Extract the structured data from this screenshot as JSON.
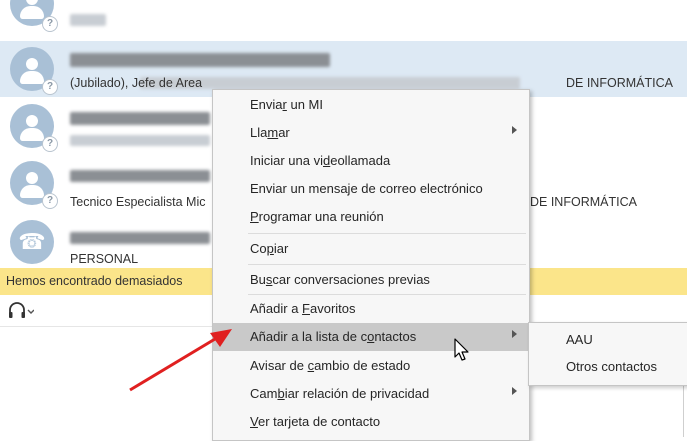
{
  "contacts": [
    {
      "line2": ""
    },
    {
      "line2_prefix": "(Jubilado), Jefe de Area",
      "line2_suffix": "DE INFORMÁTICA"
    },
    {
      "line2": ""
    },
    {
      "line2_prefix": "Tecnico Especialista Mic",
      "line2_suffix": "DE INFORMÁTICA"
    },
    {
      "line2": "PERSONAL"
    }
  ],
  "banner_text": "Hemos encontrado demasiados",
  "toolbar_icon": "headset-icon",
  "context_menu": {
    "items": [
      {
        "pre": "Envia",
        "u": "r",
        "post": " un MI"
      },
      {
        "pre": "Lla",
        "u": "m",
        "post": "ar"
      },
      {
        "pre": "Iniciar una vi",
        "u": "d",
        "post": "eollamada"
      },
      {
        "pre": "Enviar un mensaje de correo electrónico",
        "u": "",
        "post": ""
      },
      {
        "pre": "",
        "u": "P",
        "post": "rogramar una reunión"
      },
      {
        "pre": "Co",
        "u": "p",
        "post": "iar"
      },
      {
        "pre": "Bu",
        "u": "s",
        "post": "car conversaciones previas"
      },
      {
        "pre": "Añadir a ",
        "u": "F",
        "post": "avoritos"
      },
      {
        "pre": "Añadir a la lista de c",
        "u": "o",
        "post": "ntactos"
      },
      {
        "pre": "Avisar de ",
        "u": "c",
        "post": "ambio de estado"
      },
      {
        "pre": "Cam",
        "u": "b",
        "post": "iar relación de privacidad"
      },
      {
        "pre": "",
        "u": "V",
        "post": "er tarjeta de contacto"
      }
    ]
  },
  "submenu": {
    "items": [
      "AAU",
      "Otros contactos"
    ]
  },
  "colors": {
    "banner": "#fbe58a",
    "selected_row": "#dde9f4",
    "highlight": "#c9c9c9",
    "arrow": "#e02020"
  }
}
